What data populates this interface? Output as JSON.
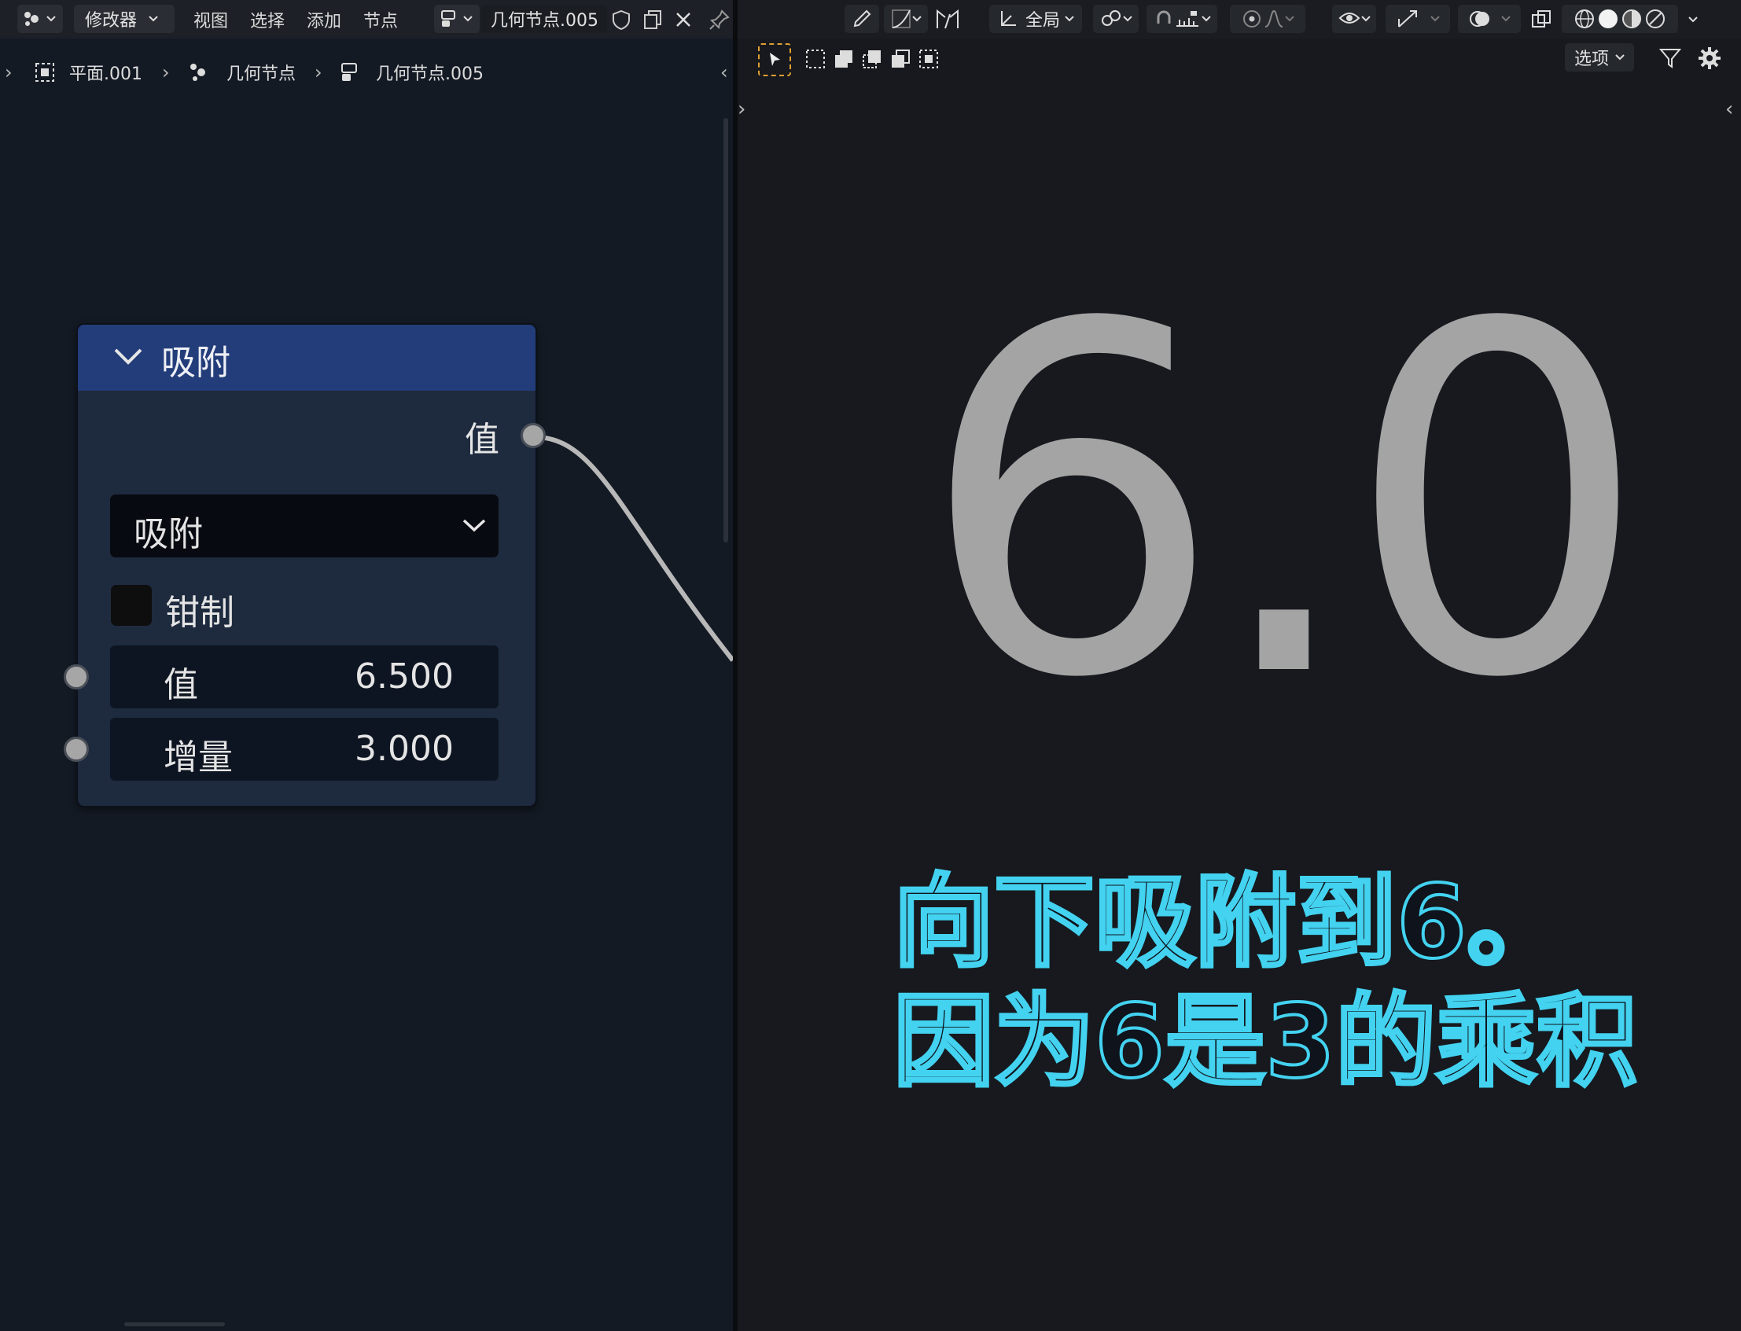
{
  "node_editor": {
    "header": {
      "editor_type_icon": "node-editor-icon",
      "mode": "修改器",
      "menus": [
        "视图",
        "选择",
        "添加",
        "节点"
      ],
      "node_group_name": "几何节点.005"
    },
    "breadcrumb": [
      "平面.001",
      "几何节点",
      "几何节点.005"
    ],
    "node": {
      "title": "吸附",
      "output_label": "值",
      "mode_option": "吸附",
      "clamp_label": "钳制",
      "clamp_checked": false,
      "inputs": [
        {
          "label": "值",
          "value": "6.500"
        },
        {
          "label": "增量",
          "value": "3.000"
        }
      ]
    }
  },
  "viewport": {
    "header": {
      "orientation": "全局",
      "options": "选项"
    },
    "display_value": "6.0",
    "caption_lines": [
      "向下吸附到6。",
      "因为6是3的乘积"
    ],
    "colors": {
      "caption_outline": "#43d2f0",
      "value": "#a4a4a4"
    }
  }
}
